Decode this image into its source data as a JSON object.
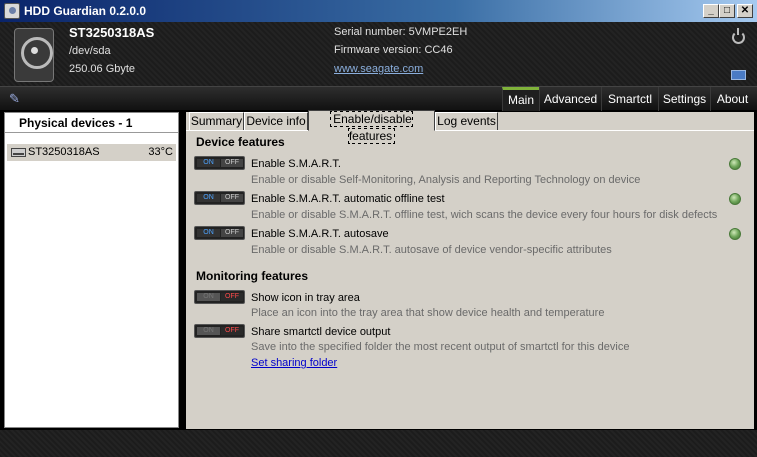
{
  "window": {
    "title": "HDD Guardian 0.2.0.0",
    "minimize": "_",
    "maximize": "□",
    "close": "✕"
  },
  "header": {
    "model": "ST3250318AS",
    "path": "/dev/sda",
    "size": "250.06 Gbyte",
    "serial": "Serial number: 5VMPE2EH",
    "firmware": "Firmware version: CC46",
    "website": "www.seagate.com"
  },
  "menu": {
    "brand_icon": "✎",
    "items": [
      {
        "label": "Main",
        "active": true
      },
      {
        "label": "Advanced"
      },
      {
        "label": "Smartctl"
      },
      {
        "label": "Settings"
      },
      {
        "label": "About"
      }
    ]
  },
  "devices": {
    "title": "Physical devices - 1",
    "items": [
      {
        "name": "ST3250318AS",
        "temp": "33°C"
      }
    ]
  },
  "tabs": [
    {
      "label": "Summary"
    },
    {
      "label": "Device info"
    },
    {
      "label": "Enable/disable features",
      "active": true
    },
    {
      "label": "Log events"
    }
  ],
  "toggle_labels": {
    "on": "ON",
    "off": "OFF"
  },
  "device_features": {
    "title": "Device features",
    "items": [
      {
        "title": "Enable S.M.A.R.T.",
        "desc": "Enable or disable Self-Monitoring, Analysis and Reporting Technology on device",
        "enabled": true
      },
      {
        "title": "Enable S.M.A.R.T. automatic offline test",
        "desc": "Enable or disable S.M.A.R.T. offline test, wich scans the device every four hours for disk defects",
        "enabled": true
      },
      {
        "title": "Enable S.M.A.R.T. autosave",
        "desc": "Enable or disable S.M.A.R.T. autosave of device vendor-specific attributes",
        "enabled": true
      }
    ]
  },
  "monitoring_features": {
    "title": "Monitoring features",
    "items": [
      {
        "title": "Show icon in tray area",
        "desc": "Place an icon into the tray area that show device health and temperature",
        "enabled": false
      },
      {
        "title": "Share smartctl device output",
        "desc": "Save into the specified folder the most recent output of smartctl for this device",
        "enabled": false
      }
    ],
    "link": "Set sharing folder"
  },
  "colors": {
    "accent": "#7fb23a",
    "on_text": "#4da3ff",
    "off_text": "#ff4a4a",
    "link": "#0000cc"
  }
}
